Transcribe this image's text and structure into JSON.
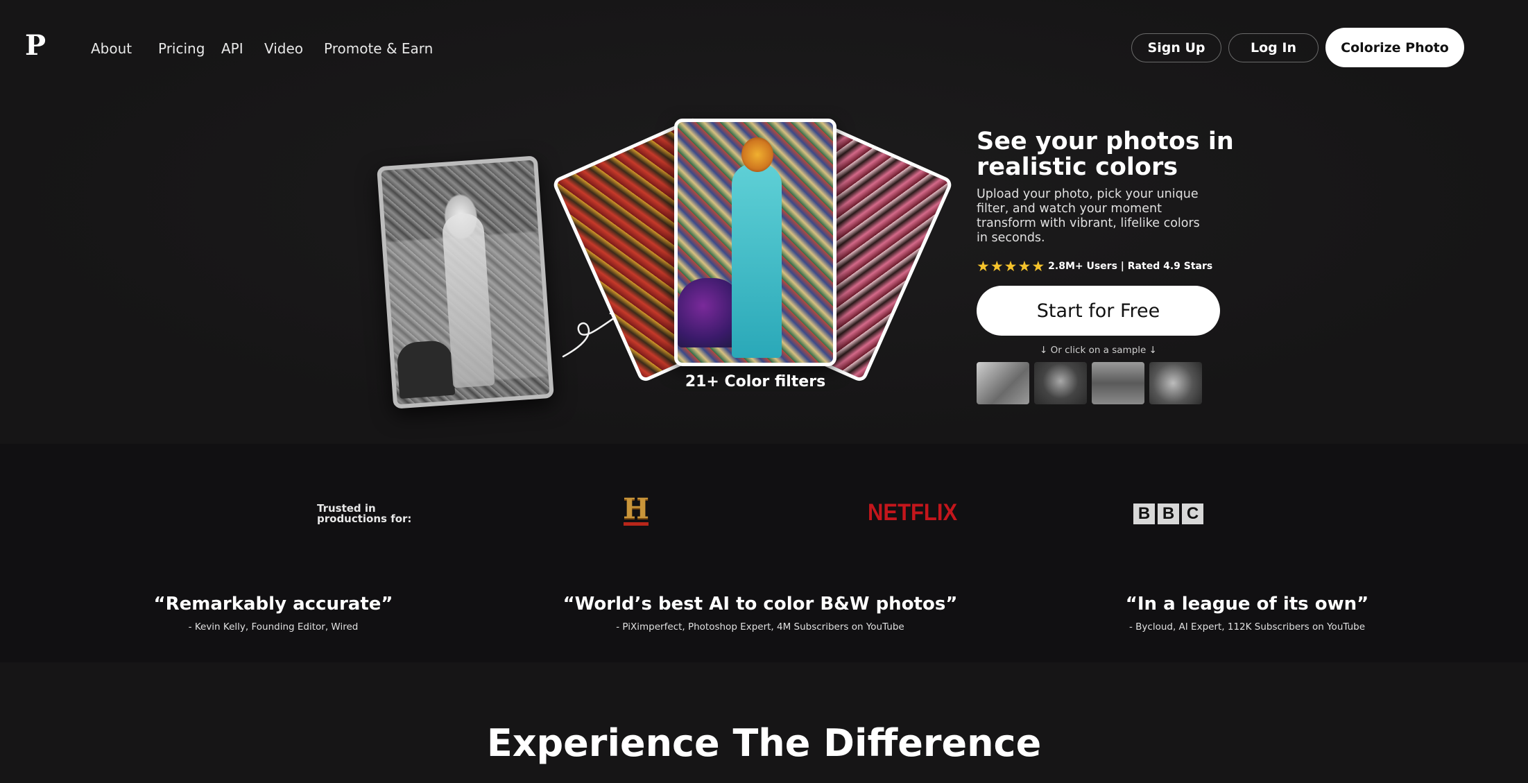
{
  "brand": {
    "logo_letter": "P"
  },
  "nav": {
    "items": [
      {
        "label": "About"
      },
      {
        "label": "Pricing"
      },
      {
        "label": "API"
      },
      {
        "label": "Video"
      },
      {
        "label": "Promote & Earn"
      }
    ]
  },
  "header_actions": {
    "signup": "Sign Up",
    "login": "Log In",
    "colorize": "Colorize Photo"
  },
  "hero": {
    "filters_caption": "21+ Color filters",
    "title": "See your photos in realistic colors",
    "subtitle": "Upload your photo, pick your unique filter, and watch your moment transform with vibrant, lifelike colors in seconds.",
    "stars": 5,
    "rating_text": "2.8M+ Users | Rated 4.9 Stars",
    "cta": "Start for Free",
    "sample_hint": "↓  Or click on a sample  ↓"
  },
  "trust": {
    "label": "Trusted in productions for:",
    "logos": {
      "history": "H",
      "netflix": "NETFLIX",
      "bbc": [
        "B",
        "B",
        "C"
      ]
    }
  },
  "quotes": [
    {
      "quote": "“Remarkably accurate”",
      "author": "- Kevin Kelly, Founding Editor, Wired"
    },
    {
      "quote": "“World’s best AI to color B&W photos”",
      "author": "- PiXimperfect, Photoshop Expert, 4M Subscribers on YouTube"
    },
    {
      "quote": "“In a league of its own”",
      "author": "- Bycloud, AI Expert, 112K Subscribers on YouTube"
    }
  ],
  "section_heading": "Experience The Difference",
  "colors": {
    "background": "#161516",
    "band": "#111012",
    "star": "#f5c32c",
    "netflix": "#c4161c",
    "history_gold": "#c9953a"
  },
  "icons": {
    "star": "star-icon",
    "arrow_doodle": "curly-arrow-icon"
  }
}
